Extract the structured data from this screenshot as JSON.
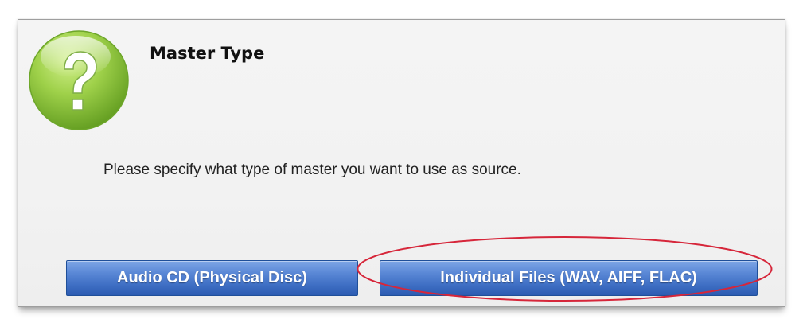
{
  "dialog": {
    "title": "Master Type",
    "message": "Please specify what type of master you want to use as source.",
    "icon": "question-mark-icon",
    "buttons": [
      {
        "label": "Audio CD (Physical Disc)"
      },
      {
        "label": "Individual Files (WAV, AIFF, FLAC)"
      }
    ],
    "highlighted_button": "Individual Files (WAV, AIFF, FLAC)"
  },
  "colors": {
    "button_blue": "#3f6fc4",
    "icon_green": "#8cc63f",
    "highlight_red": "#d6263a",
    "dialog_bg": "#f3f3f3"
  }
}
